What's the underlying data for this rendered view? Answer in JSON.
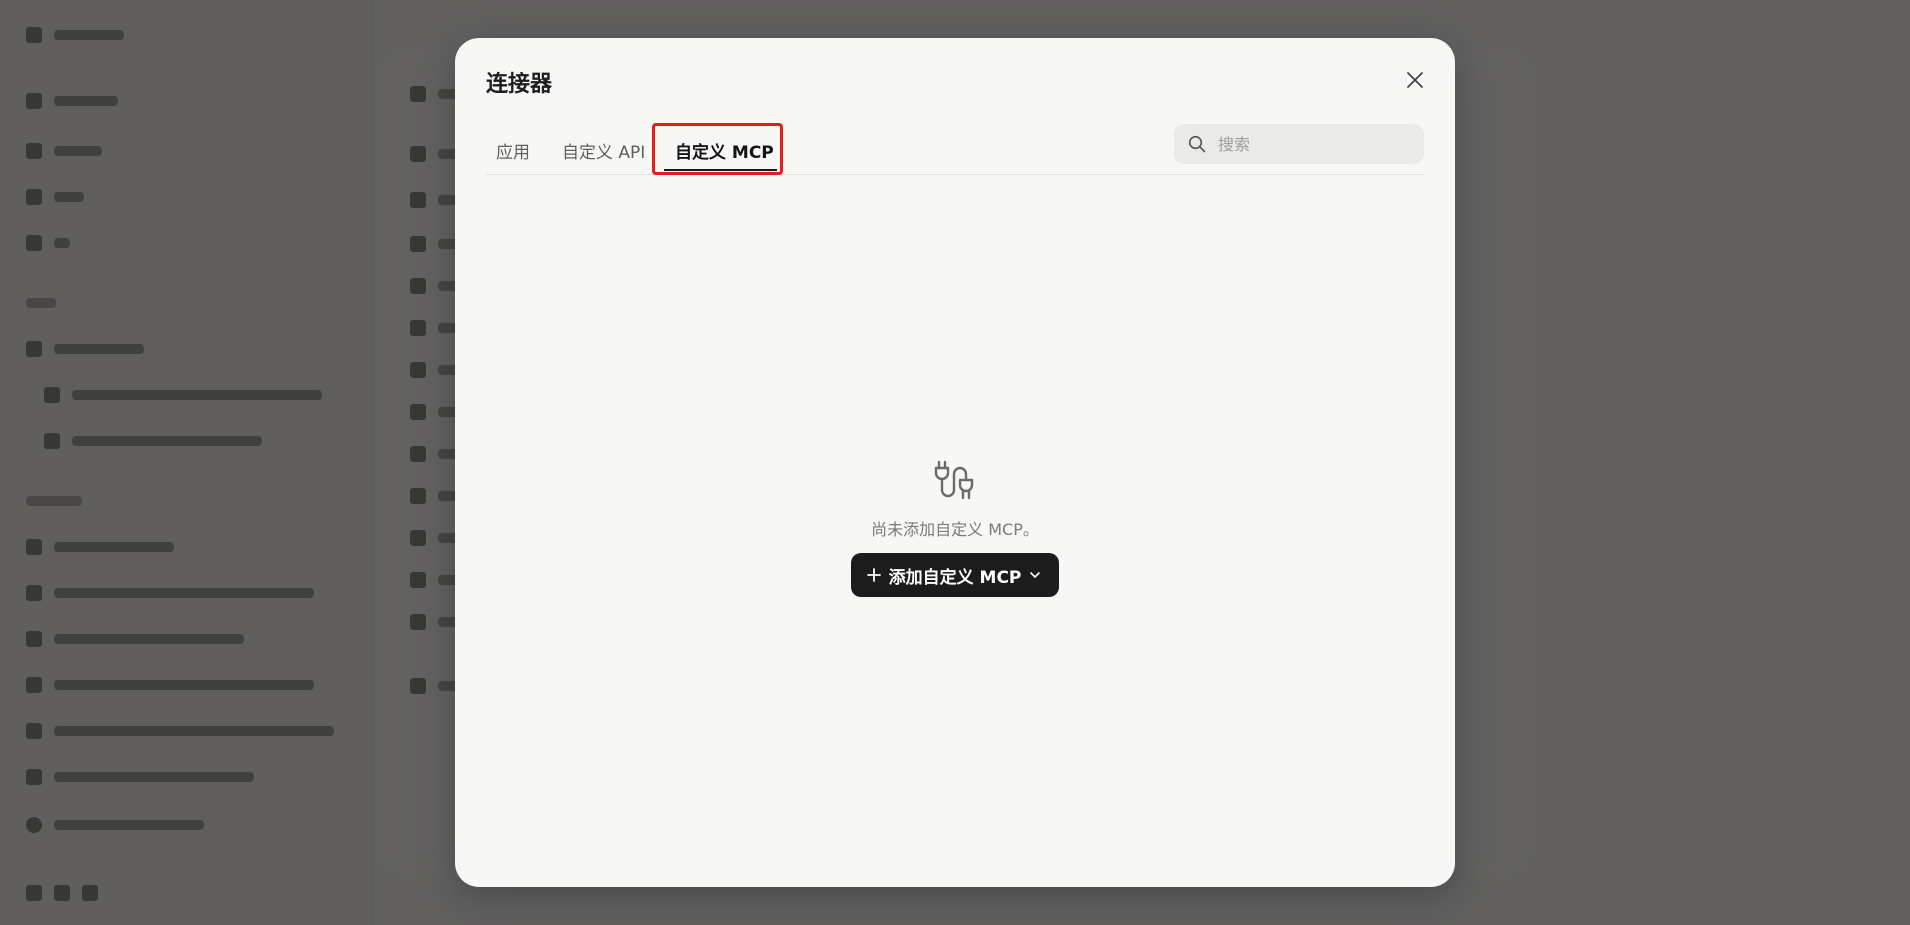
{
  "modal": {
    "title": "连接器",
    "tabs": [
      {
        "label": "应用",
        "active": false
      },
      {
        "label": "自定义 API",
        "active": false
      },
      {
        "label": "自定义 MCP",
        "active": true
      }
    ],
    "search": {
      "placeholder": "搜索",
      "value": ""
    },
    "empty_state": {
      "icon": "plug-connector-icon",
      "message": "尚未添加自定义 MCP。",
      "add_button_label": "添加自定义 MCP"
    }
  },
  "colors": {
    "overlay": "#000000",
    "modal_bg": "#f7f7f5",
    "primary_button": "#1c1c1c",
    "highlight_border": "#e11d1d"
  }
}
